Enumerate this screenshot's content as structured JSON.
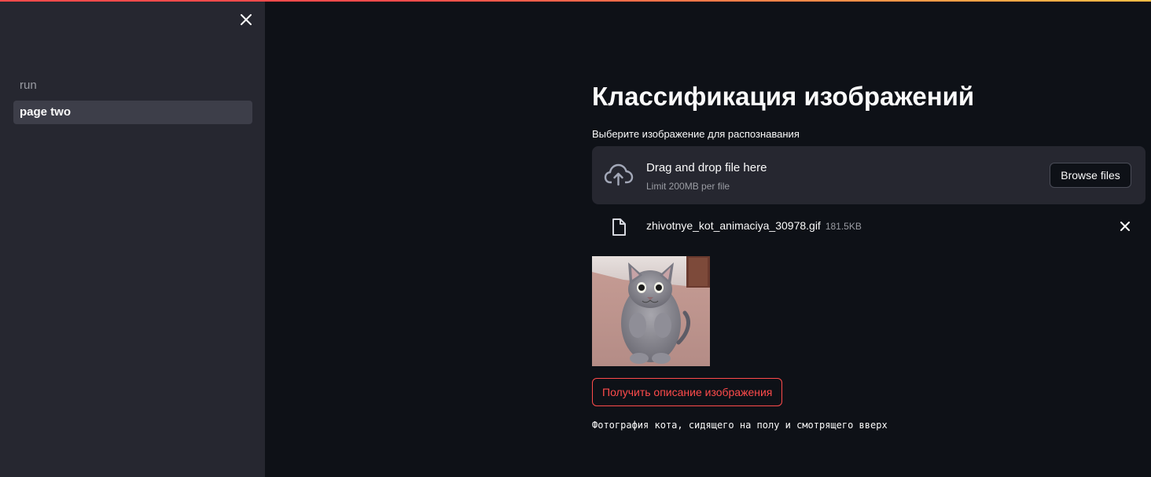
{
  "sidebar": {
    "nav_items": [
      {
        "label": "run",
        "active": false
      },
      {
        "label": "page two",
        "active": true
      }
    ]
  },
  "main": {
    "title": "Классификация изображений",
    "uploader": {
      "label": "Выберите изображение для распознавания",
      "drop_title": "Drag and drop file here",
      "limit_text": "Limit 200MB per file",
      "browse_label": "Browse files"
    },
    "uploaded_file": {
      "name": "zhivotnye_kot_animaciya_30978.gif",
      "size": "181.5KB"
    },
    "action_button_label": "Получить описание изображения",
    "result_text": "Фотография кота, сидящего на полу и смотрящего вверх"
  },
  "colors": {
    "background": "#0e1117",
    "sidebar": "#262730",
    "accent": "#ff4b4b",
    "text": "#fafafa",
    "muted": "#9a9ca3"
  },
  "icons": {
    "sidebar_close": "close-icon",
    "upload": "cloud-upload-icon",
    "file": "file-icon",
    "remove": "close-icon"
  }
}
